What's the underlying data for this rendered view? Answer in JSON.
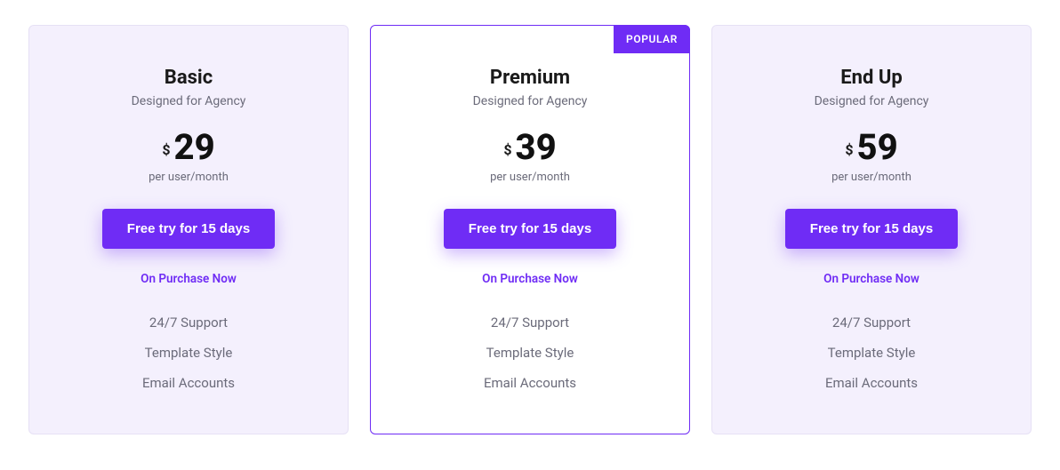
{
  "colors": {
    "accent": "#6f2cf5",
    "card_bg": "#f4f0fd",
    "featured_bg": "#ffffff"
  },
  "plans": [
    {
      "title": "Basic",
      "subtitle": "Designed for Agency",
      "currency": "$",
      "amount": "29",
      "period": "per user/month",
      "cta": "Free try for 15 days",
      "purchase_label": "On Purchase Now",
      "features": [
        "24/7 Support",
        "Template Style",
        "Email Accounts"
      ],
      "badge": null
    },
    {
      "title": "Premium",
      "subtitle": "Designed for Agency",
      "currency": "$",
      "amount": "39",
      "period": "per user/month",
      "cta": "Free try for 15 days",
      "purchase_label": "On Purchase Now",
      "features": [
        "24/7 Support",
        "Template Style",
        "Email Accounts"
      ],
      "badge": "POPULAR"
    },
    {
      "title": "End Up",
      "subtitle": "Designed for Agency",
      "currency": "$",
      "amount": "59",
      "period": "per user/month",
      "cta": "Free try for 15 days",
      "purchase_label": "On Purchase Now",
      "features": [
        "24/7 Support",
        "Template Style",
        "Email Accounts"
      ],
      "badge": null
    }
  ]
}
